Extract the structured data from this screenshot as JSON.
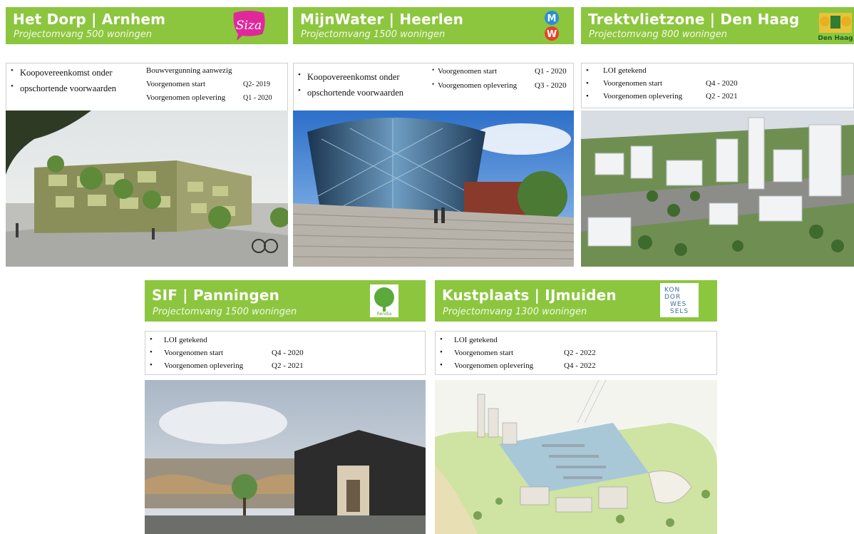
{
  "projects": [
    {
      "title": "Het Dorp | Arnhem",
      "subtitle": "Projectomvang 500 woningen",
      "logo_text": "Siza",
      "left_items": [
        "Koopovereenkomst onder",
        "opschortende voorwaarden"
      ],
      "right_items": [
        {
          "label": "Bouwvergunning aanwezig",
          "value": ""
        },
        {
          "label": "Voorgenomen start",
          "value": "Q2- 2019"
        },
        {
          "label": "Voorgenomen oplevering",
          "value": "Q1 - 2020"
        }
      ],
      "image": "rendering of green-facade apartment building with trees and cyclist"
    },
    {
      "title": "MijnWater | Heerlen",
      "subtitle": "Projectomvang 1500 woningen",
      "logo_text": "M W",
      "left_items": [
        "Koopovereenkomst onder",
        "opschortende voorwaarden"
      ],
      "right_items": [
        {
          "label": "Voorgenomen start",
          "value": "Q1 - 2020"
        },
        {
          "label": "Voorgenomen oplevering",
          "value": "Q3 - 2020"
        }
      ],
      "image": "glass dome building above wide stone staircase"
    },
    {
      "title": "Trektvlietzone | Den Haag",
      "subtitle": "Projectomvang 800 woningen",
      "logo_text": "Den Haag",
      "items": [
        {
          "label": "LOI getekend",
          "value": ""
        },
        {
          "label": "Voorgenomen start",
          "value": "Q4 - 2020"
        },
        {
          "label": "Voorgenomen oplevering",
          "value": "Q2 - 2021"
        }
      ],
      "image": "aerial 3D city model with high-rise blocks and trees"
    },
    {
      "title": "SIF | Panningen",
      "subtitle": "Projectomvang 1500 woningen",
      "logo_text": "Rendia",
      "items": [
        {
          "label": "LOI getekend",
          "value": ""
        },
        {
          "label": "Voorgenomen start",
          "value": "Q4 - 2020"
        },
        {
          "label": "Voorgenomen oplevering",
          "value": "Q2 - 2021"
        }
      ],
      "image": "rendering of dark angular building with plaza and tree"
    },
    {
      "title": "Kustplaats | IJmuiden",
      "subtitle": "Projectomvang 1300 woningen",
      "logo_text": "KON DOR WES SELS",
      "items": [
        {
          "label": "LOI getekend",
          "value": ""
        },
        {
          "label": "Voorgenomen start",
          "value": "Q2 - 2022"
        },
        {
          "label": "Voorgenomen oplevering",
          "value": "Q4 - 2022"
        }
      ],
      "image": "site plan illustration of harbour development and dunes"
    }
  ]
}
